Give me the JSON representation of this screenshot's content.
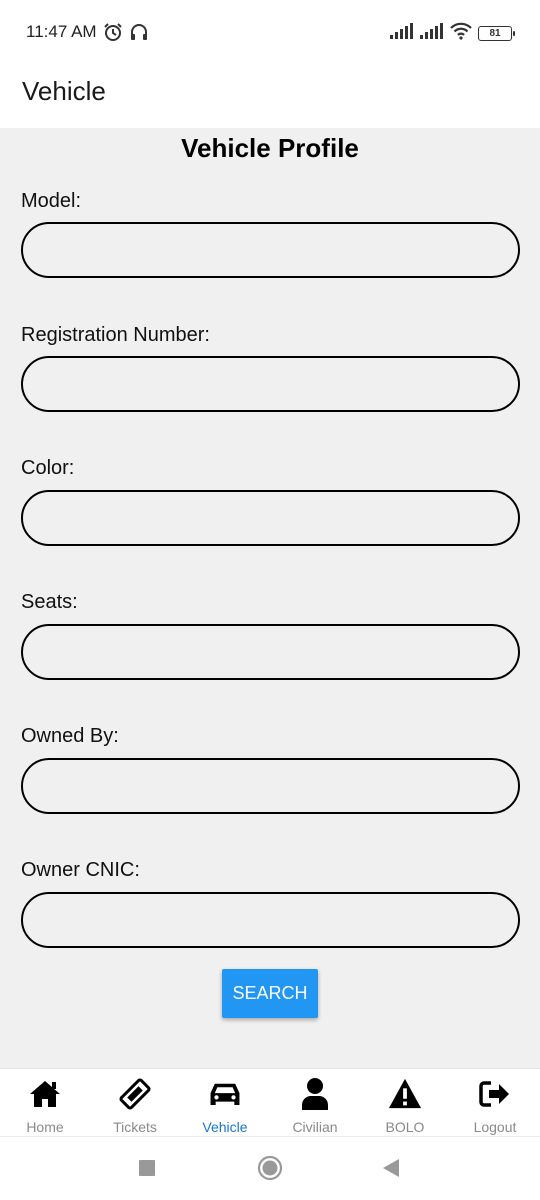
{
  "status_bar": {
    "time": "11:47 AM",
    "battery": "81"
  },
  "header": {
    "title": "Vehicle"
  },
  "page": {
    "heading": "Vehicle Profile"
  },
  "form": {
    "fields": [
      {
        "label": "Model:",
        "value": ""
      },
      {
        "label": "Registration Number:",
        "value": ""
      },
      {
        "label": "Color:",
        "value": ""
      },
      {
        "label": "Seats:",
        "value": ""
      },
      {
        "label": "Owned By:",
        "value": ""
      },
      {
        "label": "Owner CNIC:",
        "value": ""
      }
    ],
    "search_label": "SEARCH"
  },
  "nav": {
    "items": [
      {
        "label": "Home",
        "icon": "home-icon"
      },
      {
        "label": "Tickets",
        "icon": "ticket-icon"
      },
      {
        "label": "Vehicle",
        "icon": "car-icon",
        "active": true
      },
      {
        "label": "Civilian",
        "icon": "user-icon"
      },
      {
        "label": "BOLO",
        "icon": "warning-icon"
      },
      {
        "label": "Logout",
        "icon": "logout-icon"
      }
    ]
  },
  "colors": {
    "accent": "#2196f3",
    "active_nav": "#1976d2",
    "background": "#f0f0f0"
  }
}
